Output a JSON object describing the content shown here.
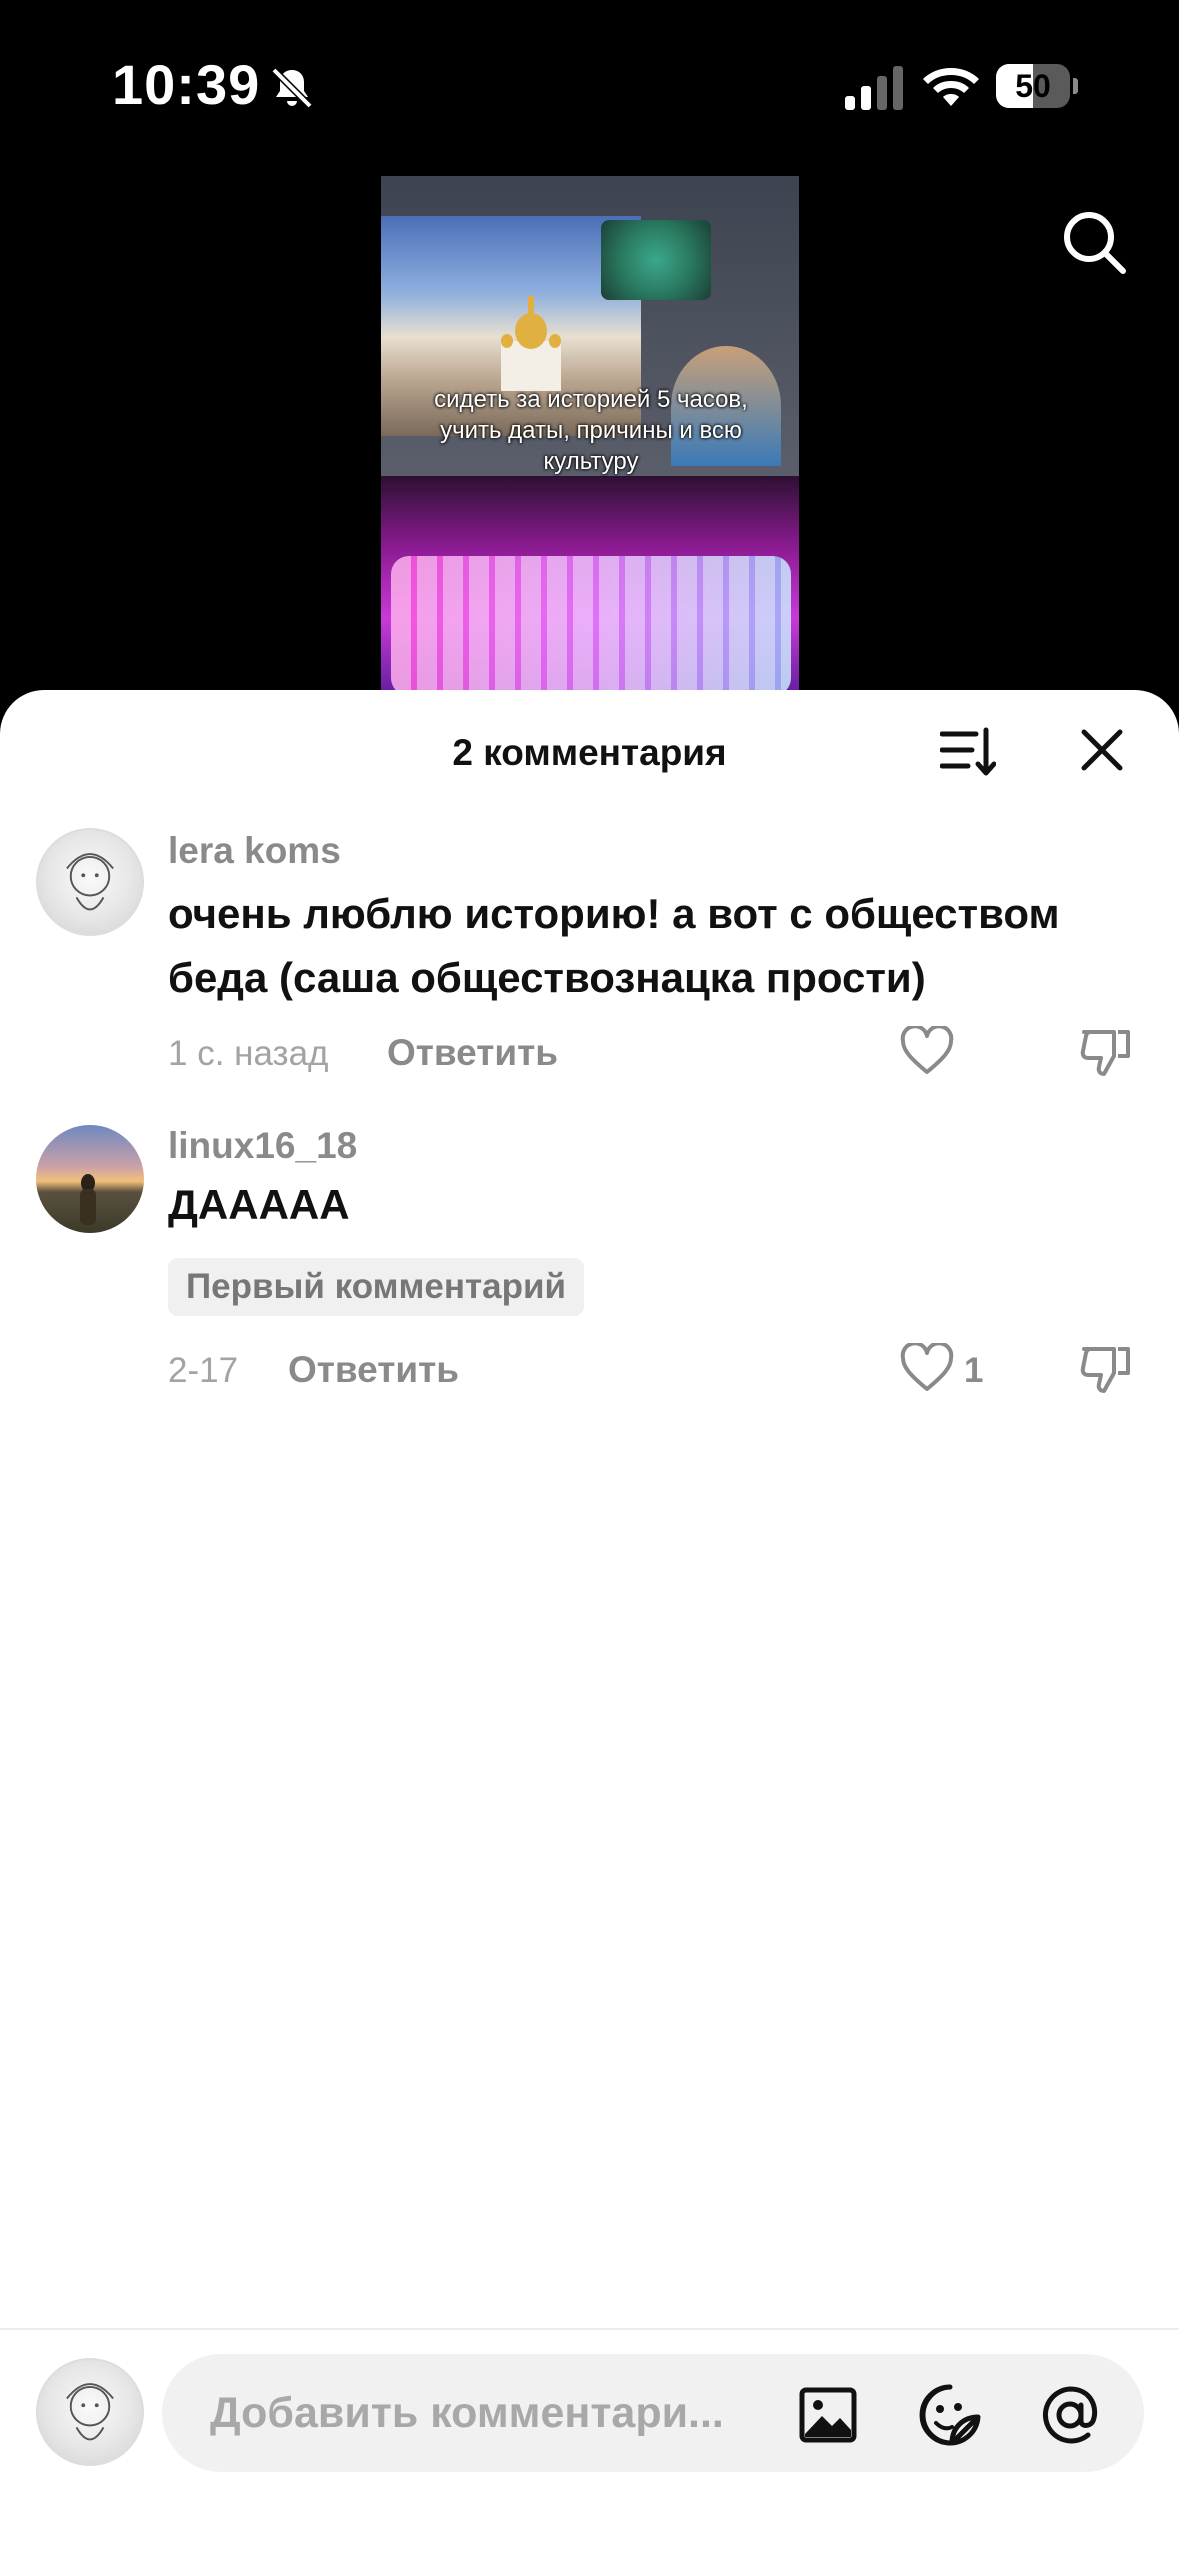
{
  "status_bar": {
    "time": "10:39",
    "battery_level": "50",
    "battery_fraction": 0.5,
    "icons": [
      "bell-slash-icon",
      "cellular-signal-icon",
      "wifi-icon",
      "battery-icon"
    ]
  },
  "video": {
    "caption": "сидеть за историей 5 часов, учить даты, причины и всю культуру"
  },
  "sheet": {
    "title": "2 комментария",
    "icons": [
      "sort-icon",
      "close-icon"
    ]
  },
  "comments": [
    {
      "username": "lera koms",
      "text": "очень люблю историю! а вот с обществом беда (саша обществознацка прости)",
      "time": "1 с. назад",
      "reply_label": "Ответить",
      "likes": "",
      "badge": ""
    },
    {
      "username": "linux16_18",
      "text": "ДААААА",
      "time": "2-17",
      "reply_label": "Ответить",
      "likes": "1",
      "badge": "Первый комментарий"
    }
  ],
  "input": {
    "placeholder": "Добавить комментари..."
  },
  "colors": {
    "muted_text": "#8a8a8a",
    "primary_text": "#111111",
    "sheet_bg": "#ffffff",
    "input_bg": "#f1f1f1"
  }
}
